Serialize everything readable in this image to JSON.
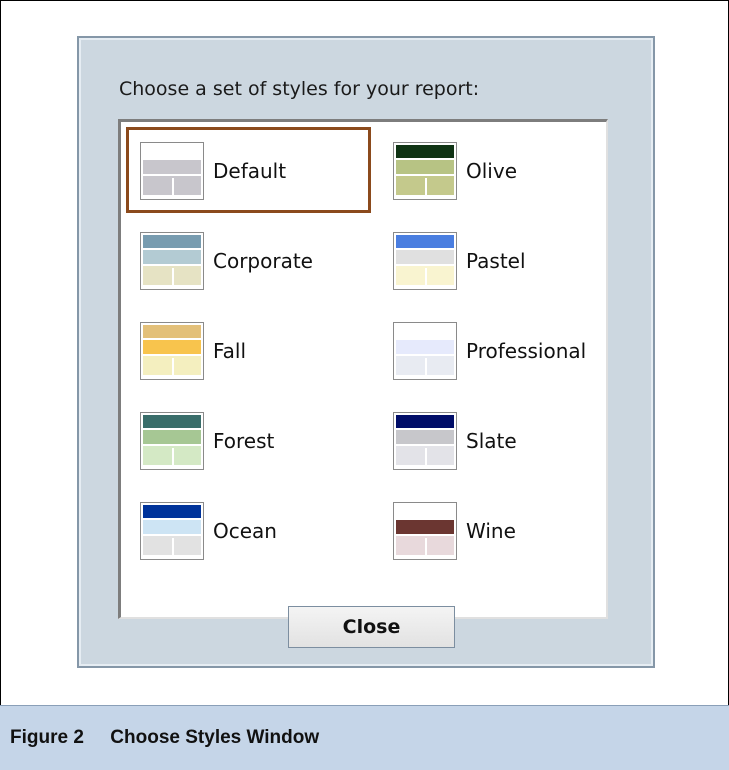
{
  "dialog": {
    "prompt": "Choose a set of styles for your report:",
    "close_label": "Close",
    "styles": [
      {
        "label": "Default",
        "selected": true,
        "colors": [
          "#ffffff",
          "#c8c6cc",
          "#c8c6cc"
        ]
      },
      {
        "label": "Olive",
        "selected": false,
        "colors": [
          "#0f3314",
          "#b7c384",
          "#c4c98c"
        ]
      },
      {
        "label": "Corporate",
        "selected": false,
        "colors": [
          "#789cb0",
          "#b3cbd3",
          "#e6e3c4"
        ]
      },
      {
        "label": "Pastel",
        "selected": false,
        "colors": [
          "#4a7ee0",
          "#e0e0e0",
          "#f9f4d0"
        ]
      },
      {
        "label": "Fall",
        "selected": false,
        "colors": [
          "#e3c079",
          "#f8c44d",
          "#f4efbf"
        ]
      },
      {
        "label": "Professional",
        "selected": false,
        "colors": [
          "#ffffff",
          "#e6eafc",
          "#e8ebf2"
        ]
      },
      {
        "label": "Forest",
        "selected": false,
        "colors": [
          "#396d6a",
          "#a6c794",
          "#d4e9c5"
        ]
      },
      {
        "label": "Slate",
        "selected": false,
        "colors": [
          "#000d68",
          "#c7c7cb",
          "#e3e3e8"
        ]
      },
      {
        "label": "Ocean",
        "selected": false,
        "colors": [
          "#00339a",
          "#cde4f4",
          "#e2e2e2"
        ]
      },
      {
        "label": "Wine",
        "selected": false,
        "colors": [
          "#ffffff",
          "#6b3631",
          "#e8d9dc"
        ]
      }
    ]
  },
  "caption": {
    "text": "Figure 2     Choose Styles Window"
  }
}
